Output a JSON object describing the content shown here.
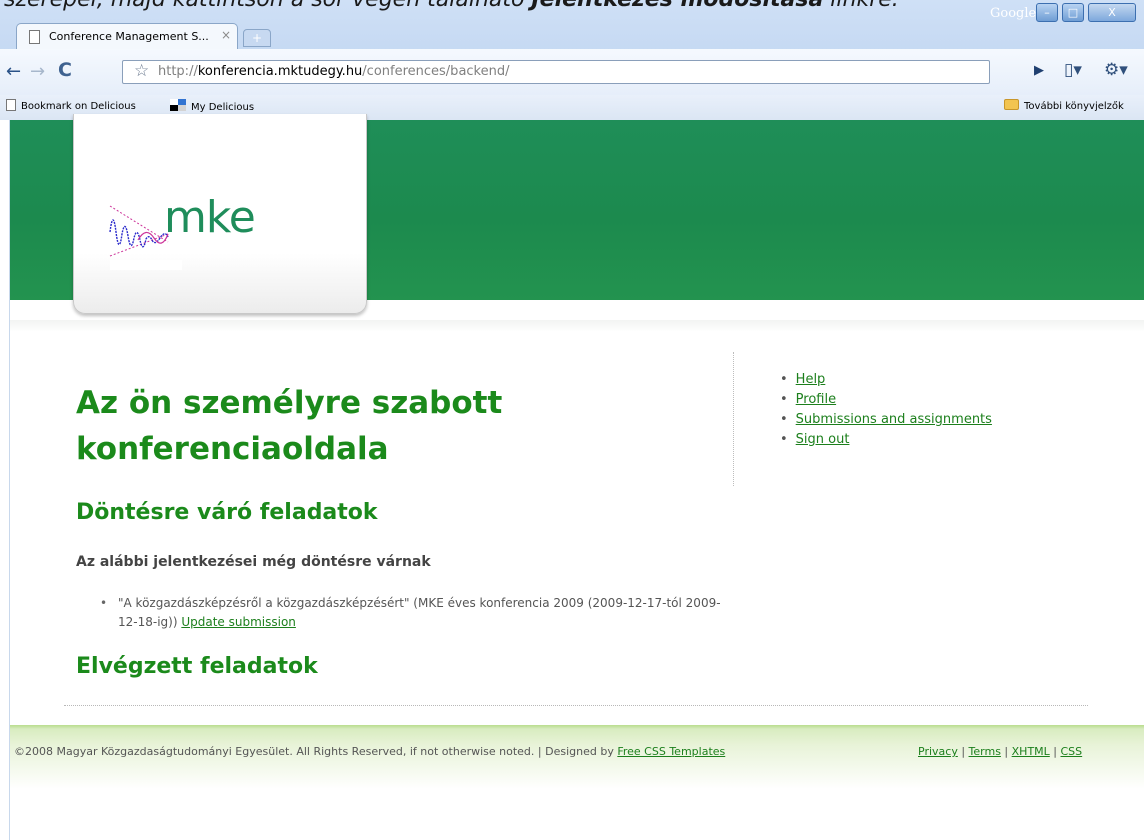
{
  "doc_overlay": {
    "prefix": "szerepel, majd kattintson a sor végén található ",
    "bold": "Jelentkezés módosítása",
    "suffix": " linkre."
  },
  "window": {
    "google_label": "Google",
    "minimize": "–",
    "maximize": "□",
    "close": "X"
  },
  "tab": {
    "title": "Conference Management S...",
    "close": "×",
    "new_tab": "+"
  },
  "toolbar": {
    "back": "←",
    "forward": "→",
    "reload": "C",
    "star": "☆",
    "url_scheme": "http://",
    "url_host": "konferencia.mktudegy.hu",
    "url_path": "/conferences/backend/",
    "play": "▶",
    "page_menu": "▯▾",
    "wrench": "⚙▾"
  },
  "bookmarks": {
    "delicious": "Bookmark on Delicious",
    "my_delicious": "My Delicious",
    "other": "További könyvjelzők"
  },
  "logo": {
    "text": "mke",
    "colors": {
      "wave": "#2b2bcc",
      "accent": "#cc3399",
      "text": "#1f8d5b"
    }
  },
  "page": {
    "title": "Az ön személyre szabott konferenciaoldala",
    "pending_heading": "Döntésre váró feladatok",
    "pending_subheading": "Az alábbi jelentkezései még döntésre várnak",
    "pending_items": [
      {
        "text": "\"A közgazdászképzésről a közgazdászképzésért\" (MKE éves konferencia 2009 (2009-12-17-tól 2009-12-18-ig)) ",
        "link": "Update submission"
      }
    ],
    "done_heading": "Elvégzett feladatok"
  },
  "sidebar": {
    "items": [
      "Help",
      "Profile",
      "Submissions and assignments",
      "Sign out"
    ]
  },
  "footer": {
    "copyright": "©2008 Magyar Közgazdaságtudományi Egyesület. All Rights Reserved, if not otherwise noted. | Designed by ",
    "designer_link": "Free CSS Templates",
    "links": [
      "Privacy",
      "Terms",
      "XHTML",
      "CSS"
    ],
    "separator": " | "
  },
  "theme": {
    "header_green": "#1c8a4e",
    "heading_green": "#1b8a1b",
    "link_green": "#1c7f1c",
    "footer_green": "#b9dd8d"
  }
}
